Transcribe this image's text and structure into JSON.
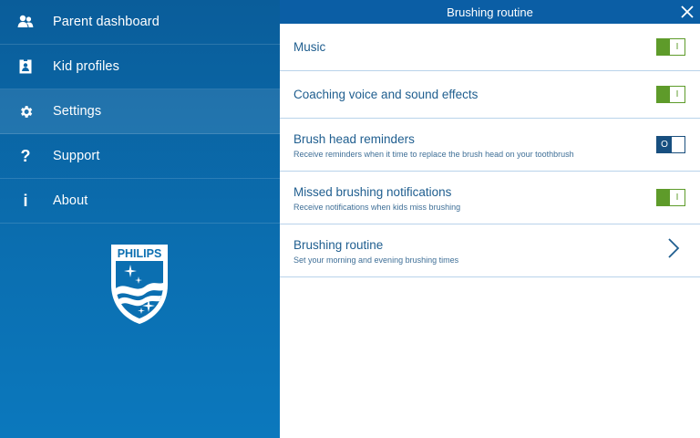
{
  "sidebar": {
    "items": [
      {
        "label": "Parent dashboard",
        "icon": "people-icon"
      },
      {
        "label": "Kid profiles",
        "icon": "profile-card-icon"
      },
      {
        "label": "Settings",
        "icon": "gear-icon"
      },
      {
        "label": "Support",
        "icon": "question-icon"
      },
      {
        "label": "About",
        "icon": "info-icon"
      }
    ],
    "active": "Settings",
    "logo_text": "PHILIPS"
  },
  "main": {
    "title": "Brushing routine",
    "rows": [
      {
        "title": "Music",
        "subtitle": "",
        "control": "toggle",
        "state": "on",
        "toggle_text": "I"
      },
      {
        "title": "Coaching voice and sound effects",
        "subtitle": "",
        "control": "toggle",
        "state": "on",
        "toggle_text": "I"
      },
      {
        "title": "Brush head reminders",
        "subtitle": "Receive reminders when it time to replace the brush head on your toothbrush",
        "control": "toggle",
        "state": "off",
        "toggle_text": "O"
      },
      {
        "title": "Missed brushing notifications",
        "subtitle": "Receive notifications when kids miss brushing",
        "control": "toggle",
        "state": "on",
        "toggle_text": "I"
      },
      {
        "title": "Brushing routine",
        "subtitle": "Set your morning and evening brushing times",
        "control": "chevron"
      }
    ]
  },
  "colors": {
    "sidebar": "#0b6fb1",
    "titlebar": "#0b5ea5",
    "toggle_on": "#5e9b2a",
    "toggle_off": "#174f80",
    "row_text": "#1f5e8f"
  }
}
